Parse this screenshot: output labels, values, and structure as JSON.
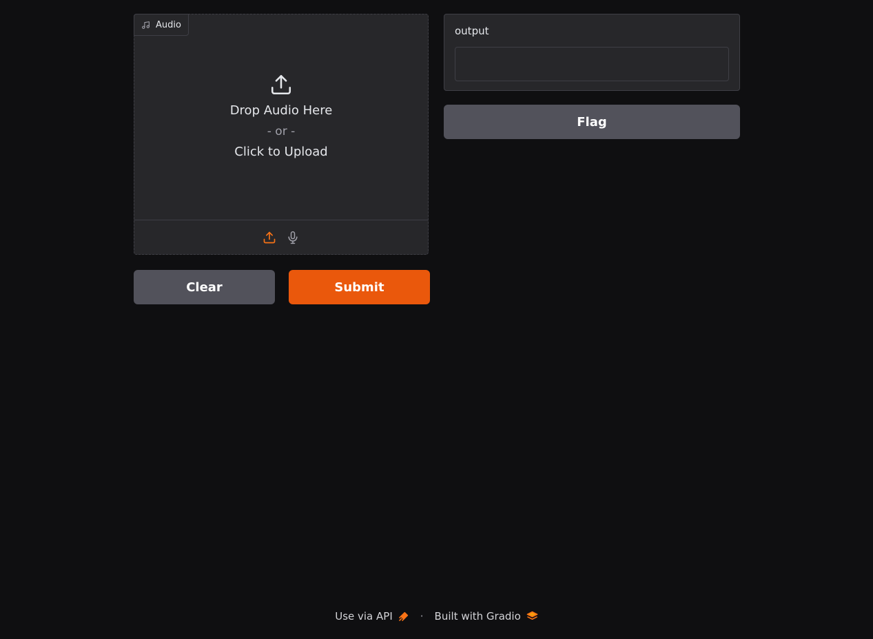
{
  "audio_input": {
    "label": "Audio",
    "drop_text": "Drop Audio Here",
    "or_text": "- or -",
    "click_text": "Click to Upload",
    "sources": [
      "upload",
      "microphone"
    ]
  },
  "actions": {
    "clear_label": "Clear",
    "submit_label": "Submit",
    "flag_label": "Flag"
  },
  "output": {
    "label": "output",
    "value": ""
  },
  "footer": {
    "api_text": "Use via API",
    "separator": "·",
    "built_with_text": "Built with Gradio"
  },
  "colors": {
    "background": "#0f0f11",
    "panel": "#27272a",
    "border": "#3f3f46",
    "secondary_button": "#52525b",
    "primary_button": "#ea580c",
    "accent": "#f97316"
  }
}
